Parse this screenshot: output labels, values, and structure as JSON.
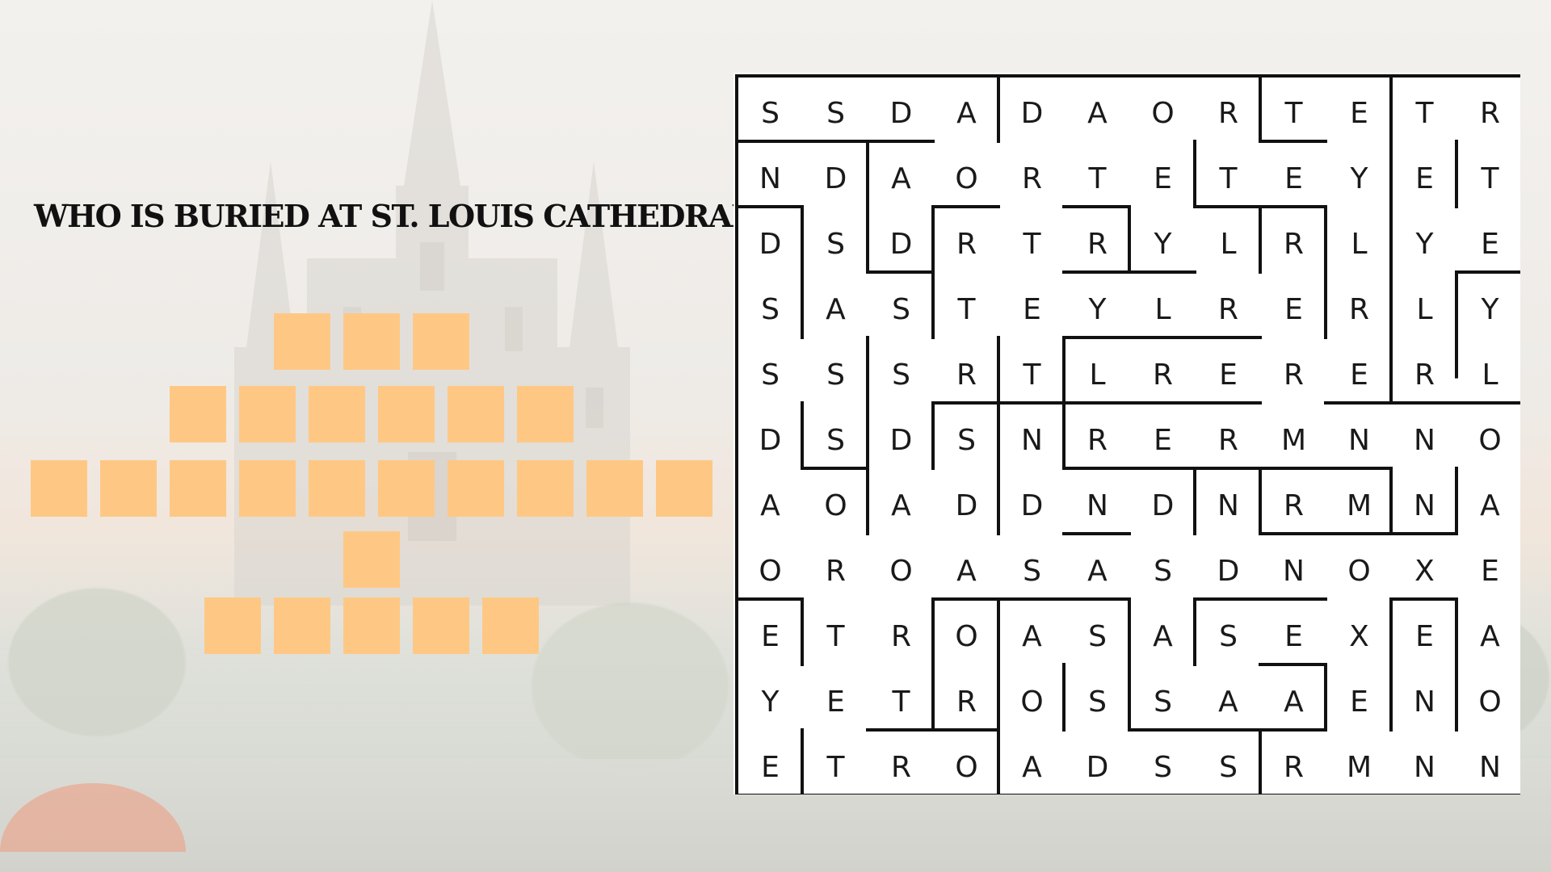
{
  "question": "WHO IS BURIED AT ST. LOUIS CATHEDRAL?",
  "answer_rows": [
    {
      "letters": 3
    },
    {
      "letters": 6
    },
    {
      "letters": 10
    },
    {
      "letters": 1
    },
    {
      "letters": 5
    }
  ],
  "colors": {
    "answer_box": "#fec884",
    "maze_line": "#111111",
    "text": "#111111"
  },
  "maze": {
    "rows": [
      [
        "S",
        "S",
        "D",
        "A",
        "D",
        "A",
        "O",
        "R",
        "T",
        "E",
        "T",
        "R"
      ],
      [
        "N",
        "D",
        "A",
        "O",
        "R",
        "T",
        "E",
        "T",
        "E",
        "Y",
        "E",
        "T"
      ],
      [
        "D",
        "S",
        "D",
        "R",
        "T",
        "R",
        "Y",
        "L",
        "R",
        "L",
        "Y",
        "E"
      ],
      [
        "S",
        "A",
        "S",
        "T",
        "E",
        "Y",
        "L",
        "R",
        "E",
        "R",
        "L",
        "Y"
      ],
      [
        "S",
        "S",
        "S",
        "R",
        "T",
        "L",
        "R",
        "E",
        "R",
        "E",
        "R",
        "L"
      ],
      [
        "D",
        "S",
        "D",
        "S",
        "N",
        "R",
        "E",
        "R",
        "M",
        "N",
        "N",
        "O"
      ],
      [
        "A",
        "O",
        "A",
        "D",
        "D",
        "N",
        "D",
        "N",
        "R",
        "M",
        "N",
        "A"
      ],
      [
        "O",
        "R",
        "O",
        "A",
        "S",
        "A",
        "S",
        "D",
        "N",
        "O",
        "X",
        "E"
      ],
      [
        "E",
        "T",
        "R",
        "O",
        "A",
        "S",
        "A",
        "S",
        "E",
        "X",
        "E",
        "A"
      ],
      [
        "Y",
        "E",
        "T",
        "R",
        "O",
        "S",
        "S",
        "A",
        "A",
        "E",
        "N",
        "O"
      ],
      [
        "E",
        "T",
        "R",
        "O",
        "A",
        "D",
        "S",
        "S",
        "R",
        "M",
        "N",
        "N"
      ]
    ]
  }
}
